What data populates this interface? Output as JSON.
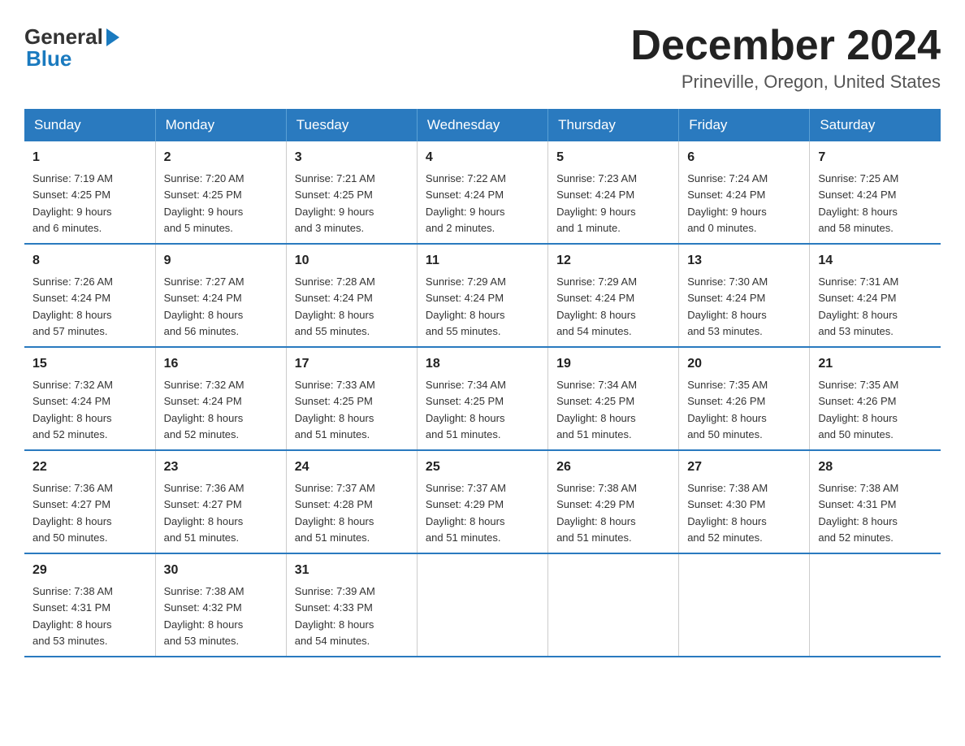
{
  "header": {
    "logo_line1": "General",
    "logo_line2": "Blue",
    "month_title": "December 2024",
    "location": "Prineville, Oregon, United States"
  },
  "weekdays": [
    "Sunday",
    "Monday",
    "Tuesday",
    "Wednesday",
    "Thursday",
    "Friday",
    "Saturday"
  ],
  "weeks": [
    [
      {
        "day": "1",
        "sunrise": "Sunrise: 7:19 AM",
        "sunset": "Sunset: 4:25 PM",
        "daylight": "Daylight: 9 hours",
        "daylight2": "and 6 minutes."
      },
      {
        "day": "2",
        "sunrise": "Sunrise: 7:20 AM",
        "sunset": "Sunset: 4:25 PM",
        "daylight": "Daylight: 9 hours",
        "daylight2": "and 5 minutes."
      },
      {
        "day": "3",
        "sunrise": "Sunrise: 7:21 AM",
        "sunset": "Sunset: 4:25 PM",
        "daylight": "Daylight: 9 hours",
        "daylight2": "and 3 minutes."
      },
      {
        "day": "4",
        "sunrise": "Sunrise: 7:22 AM",
        "sunset": "Sunset: 4:24 PM",
        "daylight": "Daylight: 9 hours",
        "daylight2": "and 2 minutes."
      },
      {
        "day": "5",
        "sunrise": "Sunrise: 7:23 AM",
        "sunset": "Sunset: 4:24 PM",
        "daylight": "Daylight: 9 hours",
        "daylight2": "and 1 minute."
      },
      {
        "day": "6",
        "sunrise": "Sunrise: 7:24 AM",
        "sunset": "Sunset: 4:24 PM",
        "daylight": "Daylight: 9 hours",
        "daylight2": "and 0 minutes."
      },
      {
        "day": "7",
        "sunrise": "Sunrise: 7:25 AM",
        "sunset": "Sunset: 4:24 PM",
        "daylight": "Daylight: 8 hours",
        "daylight2": "and 58 minutes."
      }
    ],
    [
      {
        "day": "8",
        "sunrise": "Sunrise: 7:26 AM",
        "sunset": "Sunset: 4:24 PM",
        "daylight": "Daylight: 8 hours",
        "daylight2": "and 57 minutes."
      },
      {
        "day": "9",
        "sunrise": "Sunrise: 7:27 AM",
        "sunset": "Sunset: 4:24 PM",
        "daylight": "Daylight: 8 hours",
        "daylight2": "and 56 minutes."
      },
      {
        "day": "10",
        "sunrise": "Sunrise: 7:28 AM",
        "sunset": "Sunset: 4:24 PM",
        "daylight": "Daylight: 8 hours",
        "daylight2": "and 55 minutes."
      },
      {
        "day": "11",
        "sunrise": "Sunrise: 7:29 AM",
        "sunset": "Sunset: 4:24 PM",
        "daylight": "Daylight: 8 hours",
        "daylight2": "and 55 minutes."
      },
      {
        "day": "12",
        "sunrise": "Sunrise: 7:29 AM",
        "sunset": "Sunset: 4:24 PM",
        "daylight": "Daylight: 8 hours",
        "daylight2": "and 54 minutes."
      },
      {
        "day": "13",
        "sunrise": "Sunrise: 7:30 AM",
        "sunset": "Sunset: 4:24 PM",
        "daylight": "Daylight: 8 hours",
        "daylight2": "and 53 minutes."
      },
      {
        "day": "14",
        "sunrise": "Sunrise: 7:31 AM",
        "sunset": "Sunset: 4:24 PM",
        "daylight": "Daylight: 8 hours",
        "daylight2": "and 53 minutes."
      }
    ],
    [
      {
        "day": "15",
        "sunrise": "Sunrise: 7:32 AM",
        "sunset": "Sunset: 4:24 PM",
        "daylight": "Daylight: 8 hours",
        "daylight2": "and 52 minutes."
      },
      {
        "day": "16",
        "sunrise": "Sunrise: 7:32 AM",
        "sunset": "Sunset: 4:24 PM",
        "daylight": "Daylight: 8 hours",
        "daylight2": "and 52 minutes."
      },
      {
        "day": "17",
        "sunrise": "Sunrise: 7:33 AM",
        "sunset": "Sunset: 4:25 PM",
        "daylight": "Daylight: 8 hours",
        "daylight2": "and 51 minutes."
      },
      {
        "day": "18",
        "sunrise": "Sunrise: 7:34 AM",
        "sunset": "Sunset: 4:25 PM",
        "daylight": "Daylight: 8 hours",
        "daylight2": "and 51 minutes."
      },
      {
        "day": "19",
        "sunrise": "Sunrise: 7:34 AM",
        "sunset": "Sunset: 4:25 PM",
        "daylight": "Daylight: 8 hours",
        "daylight2": "and 51 minutes."
      },
      {
        "day": "20",
        "sunrise": "Sunrise: 7:35 AM",
        "sunset": "Sunset: 4:26 PM",
        "daylight": "Daylight: 8 hours",
        "daylight2": "and 50 minutes."
      },
      {
        "day": "21",
        "sunrise": "Sunrise: 7:35 AM",
        "sunset": "Sunset: 4:26 PM",
        "daylight": "Daylight: 8 hours",
        "daylight2": "and 50 minutes."
      }
    ],
    [
      {
        "day": "22",
        "sunrise": "Sunrise: 7:36 AM",
        "sunset": "Sunset: 4:27 PM",
        "daylight": "Daylight: 8 hours",
        "daylight2": "and 50 minutes."
      },
      {
        "day": "23",
        "sunrise": "Sunrise: 7:36 AM",
        "sunset": "Sunset: 4:27 PM",
        "daylight": "Daylight: 8 hours",
        "daylight2": "and 51 minutes."
      },
      {
        "day": "24",
        "sunrise": "Sunrise: 7:37 AM",
        "sunset": "Sunset: 4:28 PM",
        "daylight": "Daylight: 8 hours",
        "daylight2": "and 51 minutes."
      },
      {
        "day": "25",
        "sunrise": "Sunrise: 7:37 AM",
        "sunset": "Sunset: 4:29 PM",
        "daylight": "Daylight: 8 hours",
        "daylight2": "and 51 minutes."
      },
      {
        "day": "26",
        "sunrise": "Sunrise: 7:38 AM",
        "sunset": "Sunset: 4:29 PM",
        "daylight": "Daylight: 8 hours",
        "daylight2": "and 51 minutes."
      },
      {
        "day": "27",
        "sunrise": "Sunrise: 7:38 AM",
        "sunset": "Sunset: 4:30 PM",
        "daylight": "Daylight: 8 hours",
        "daylight2": "and 52 minutes."
      },
      {
        "day": "28",
        "sunrise": "Sunrise: 7:38 AM",
        "sunset": "Sunset: 4:31 PM",
        "daylight": "Daylight: 8 hours",
        "daylight2": "and 52 minutes."
      }
    ],
    [
      {
        "day": "29",
        "sunrise": "Sunrise: 7:38 AM",
        "sunset": "Sunset: 4:31 PM",
        "daylight": "Daylight: 8 hours",
        "daylight2": "and 53 minutes."
      },
      {
        "day": "30",
        "sunrise": "Sunrise: 7:38 AM",
        "sunset": "Sunset: 4:32 PM",
        "daylight": "Daylight: 8 hours",
        "daylight2": "and 53 minutes."
      },
      {
        "day": "31",
        "sunrise": "Sunrise: 7:39 AM",
        "sunset": "Sunset: 4:33 PM",
        "daylight": "Daylight: 8 hours",
        "daylight2": "and 54 minutes."
      },
      null,
      null,
      null,
      null
    ]
  ]
}
